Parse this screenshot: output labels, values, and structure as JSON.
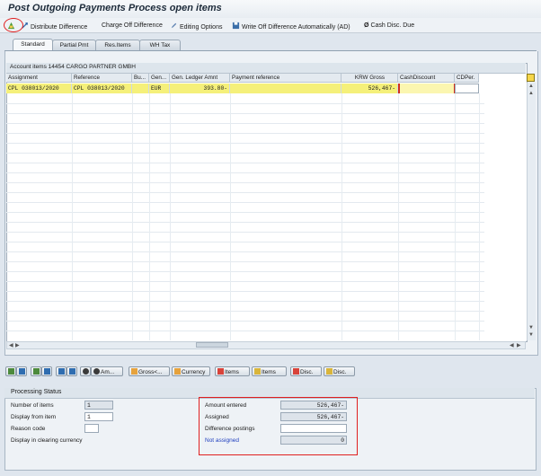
{
  "window": {
    "title": "Post Outgoing Payments Process open items"
  },
  "toolbar": {
    "items": [
      {
        "label": "Distribute Difference",
        "icon": "distribute-icon"
      },
      {
        "label": "Charge Off Difference",
        "icon": ""
      },
      {
        "label": "Editing Options",
        "icon": "pencil-icon"
      },
      {
        "label": "Write Off Difference Automatically (AD)",
        "icon": "save-icon"
      },
      {
        "label": "Cash Disc. Due",
        "icon": "slashed-zero-icon"
      }
    ]
  },
  "tabs": [
    {
      "label": "Standard",
      "active": true
    },
    {
      "label": "Partial Pmt",
      "active": false
    },
    {
      "label": "Res.Items",
      "active": false
    },
    {
      "label": "WH Tax",
      "active": false
    }
  ],
  "grid": {
    "caption": "Account items 14454 CARGO PARTNER GMBH",
    "columns": [
      "Assignment",
      "Reference",
      "Bu...",
      "Gen...",
      "Gen. Ledger Amnt",
      "Payment reference",
      "KRW Gross",
      "CashDiscount",
      "CDPer."
    ],
    "rows": [
      {
        "assignment": "CPL 038013/2020",
        "reference": "CPL 038013/2020",
        "bu": "",
        "gen": "EUR",
        "gl_amount": "393.80-",
        "payment_reference": "",
        "krw_gross": "526,467-",
        "cash_discount": "",
        "cd_per": ""
      }
    ]
  },
  "action_buttons": [
    {
      "label": "",
      "icon": "select-all-icon"
    },
    {
      "label": "",
      "icon": "deselect-all-icon"
    },
    {
      "label": "",
      "icon": "select-block-icon"
    },
    {
      "label": "",
      "icon": "deselect-block-icon"
    },
    {
      "label": "",
      "icon": "sort-asc-icon"
    },
    {
      "label": "",
      "icon": "sort-desc-icon"
    },
    {
      "label": "",
      "icon": "find-icon"
    },
    {
      "label": "Am...",
      "icon": "find-next-icon"
    },
    {
      "label": "Gross<...",
      "icon": "gross-icon"
    },
    {
      "label": "Currency",
      "icon": "currency-icon"
    },
    {
      "label": "Items",
      "icon": "activate-items-icon"
    },
    {
      "label": "Items",
      "icon": "deactivate-items-icon"
    },
    {
      "label": "Disc.",
      "icon": "activate-disc-icon"
    },
    {
      "label": "Disc.",
      "icon": "deactivate-disc-icon"
    }
  ],
  "processing_status": {
    "caption": "Processing Status",
    "number_of_items_label": "Number of items",
    "number_of_items": "1",
    "display_from_item_label": "Display from item",
    "display_from_item": "1",
    "reason_code_label": "Reason code",
    "reason_code": "",
    "display_clearing_currency_label": "Display in clearing currency",
    "amount_entered_label": "Amount entered",
    "amount_entered": "526,467-",
    "assigned_label": "Assigned",
    "assigned": "526,467-",
    "difference_postings_label": "Difference postings",
    "difference_postings": "",
    "not_assigned_label": "Not assigned",
    "not_assigned": "0"
  },
  "colors": {
    "highlight_row": "#f5f07a",
    "annotation_red": "#e02020",
    "not_assigned_blue": "#1f3fbf"
  }
}
